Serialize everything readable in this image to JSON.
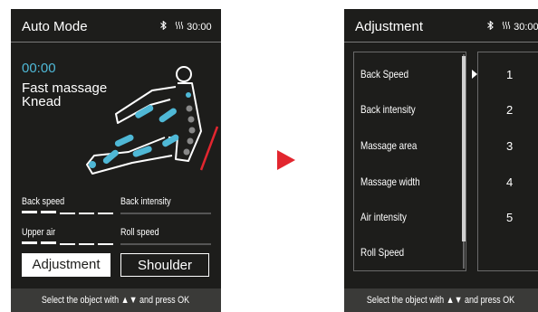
{
  "colors": {
    "accent": "#4fb8d6",
    "screen_bg": "#1d1d1b",
    "arrow": "#e2262f",
    "text": "#ffffff"
  },
  "auto_screen": {
    "title": "Auto Mode",
    "status": {
      "bluetooth_icon": "bluetooth-icon",
      "heat_icon": "heat-icon",
      "time": "30:00"
    },
    "timer": "00:00",
    "program_line1": "Fast massage",
    "program_line2": "Knead",
    "settings": [
      {
        "label": "Back speed",
        "level_filled": 2,
        "level_total": 5
      },
      {
        "label": "Back intensity",
        "level_filled": 0,
        "level_total": 5
      },
      {
        "label": "Upper air",
        "level_filled": 2,
        "level_total": 5
      },
      {
        "label": "Roll speed",
        "level_filled": 0,
        "level_total": 5
      }
    ],
    "buttons": {
      "adjustment": "Adjustment",
      "shoulder": "Shoulder"
    },
    "footer": "Select the object with ▲▼ and press OK"
  },
  "adjustment_screen": {
    "title": "Adjustment",
    "status": {
      "bluetooth_icon": "bluetooth-icon",
      "heat_icon": "heat-icon",
      "time": "30:00"
    },
    "items": [
      "Back Speed",
      "Back intensity",
      "Massage area",
      "Massage width",
      "Air intensity",
      "Roll Speed"
    ],
    "values": [
      "1",
      "2",
      "3",
      "4",
      "5"
    ],
    "footer": "Select the object with ▲▼ and press OK"
  }
}
